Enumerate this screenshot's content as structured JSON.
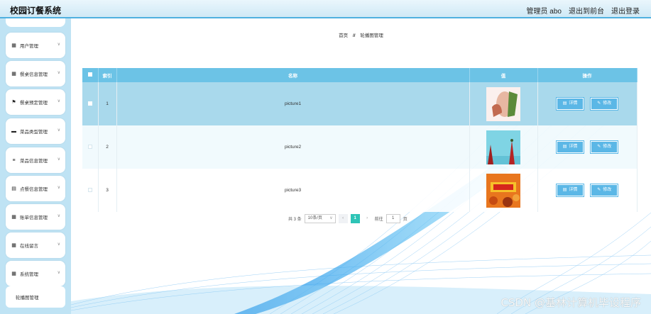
{
  "header": {
    "app_title": "校园订餐系统",
    "admin_label": "管理员 abo",
    "back_to_front": "退出到前台",
    "logout": "退出登录"
  },
  "sidebar": {
    "items": [
      {
        "label": "用户管理",
        "icon": "grid-icon"
      },
      {
        "label": "餐桌信息管理",
        "icon": "grid-icon"
      },
      {
        "label": "餐桌预定管理",
        "icon": "flag-icon"
      },
      {
        "label": "菜品类型管理",
        "icon": "card-icon"
      },
      {
        "label": "菜品信息管理",
        "icon": "sliders-icon"
      },
      {
        "label": "点餐信息管理",
        "icon": "list-icon"
      },
      {
        "label": "账单信息管理",
        "icon": "grid-icon"
      },
      {
        "label": "在线留言",
        "icon": "grid-icon"
      },
      {
        "label": "系统管理",
        "icon": "grid-icon"
      }
    ],
    "sub_item": "轮播图管理"
  },
  "breadcrumb": {
    "home": "首页",
    "separator": "//",
    "current": "轮播图管理"
  },
  "table": {
    "headers": {
      "index": "索引",
      "name": "名称",
      "value": "值",
      "actions": "操作"
    },
    "rows": [
      {
        "index": "1",
        "name": "picture1",
        "image": "pic1"
      },
      {
        "index": "2",
        "name": "picture2",
        "image": "pic2"
      },
      {
        "index": "3",
        "name": "picture3",
        "image": "pic3"
      }
    ],
    "detail_label": "详情",
    "edit_label": "修改"
  },
  "pagination": {
    "total": "共 3 条",
    "page_size": "10条/页",
    "current_page": "1",
    "goto_label": "前往",
    "goto_value": "1",
    "page_suffix": "页"
  },
  "watermark": "CSDN @基林计算机毕设程序",
  "colors": {
    "header_accent": "#4fb0e0",
    "table_header": "#6cc3e6",
    "button": "#5bb7e6",
    "active_page": "#2ec4b6",
    "sidebar_bg": "#bfe3f4"
  }
}
